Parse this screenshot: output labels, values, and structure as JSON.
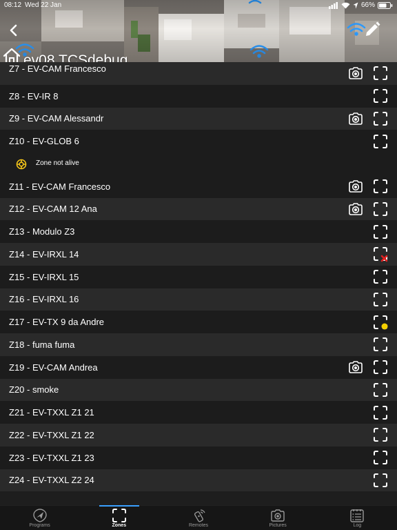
{
  "status_bar": {
    "time": "08:12",
    "date": "Wed 22 Jan",
    "battery": "66%"
  },
  "header": {
    "title": "ev08 TCSdebug"
  },
  "zones": [
    {
      "label": "Z7 - EV-CAM Francesco",
      "camera": true,
      "state": "normal",
      "partial": true
    },
    {
      "label": "Z8 - EV-IR 8",
      "camera": false,
      "state": "normal"
    },
    {
      "label": "Z9 - EV-CAM Alessandr",
      "camera": true,
      "state": "normal"
    },
    {
      "label": "Z10 - EV-GLOB 6",
      "camera": false,
      "state": "normal",
      "sub_status": "Zone not alive"
    },
    {
      "label": "Z11 - EV-CAM Francesco",
      "camera": true,
      "state": "normal"
    },
    {
      "label": "Z12 - EV-CAM 12 Ana",
      "camera": true,
      "state": "normal"
    },
    {
      "label": "Z13 - Modulo Z3",
      "camera": false,
      "state": "normal"
    },
    {
      "label": "Z14 - EV-IRXL 14",
      "camera": false,
      "state": "excluded"
    },
    {
      "label": "Z15 - EV-IRXL 15",
      "camera": false,
      "state": "normal"
    },
    {
      "label": "Z16 - EV-IRXL 16",
      "camera": false,
      "state": "normal"
    },
    {
      "label": "Z17 - EV-TX 9 da Andre",
      "camera": false,
      "state": "warning"
    },
    {
      "label": "Z18 - fuma fuma",
      "camera": false,
      "state": "normal"
    },
    {
      "label": "Z19 - EV-CAM Andrea",
      "camera": true,
      "state": "normal"
    },
    {
      "label": "Z20 - smoke",
      "camera": false,
      "state": "normal"
    },
    {
      "label": "Z21 - EV-TXXL Z1 21",
      "camera": false,
      "state": "normal"
    },
    {
      "label": "Z22 - EV-TXXL Z1 22",
      "camera": false,
      "state": "normal"
    },
    {
      "label": "Z23 - EV-TXXL Z1 23",
      "camera": false,
      "state": "normal"
    },
    {
      "label": "Z24 - EV-TXXL Z2 24",
      "camera": false,
      "state": "normal"
    }
  ],
  "tabs": [
    {
      "label": "Programs",
      "icon": "shield-plane-icon",
      "active": false
    },
    {
      "label": "Zones",
      "icon": "zone-frame-icon",
      "active": true
    },
    {
      "label": "Remotes",
      "icon": "remote-control-icon",
      "active": false
    },
    {
      "label": "Pictures",
      "icon": "camera-icon",
      "active": false
    },
    {
      "label": "Log",
      "icon": "log-list-icon",
      "active": false
    }
  ],
  "colors": {
    "accent": "#3aa0ff",
    "warning_dot": "#f5d000",
    "excluded_x": "#e02020",
    "sub_status_icon": "#f5c518",
    "row_alt": "#2a2a2a",
    "row_dark": "#1c1c1c"
  }
}
